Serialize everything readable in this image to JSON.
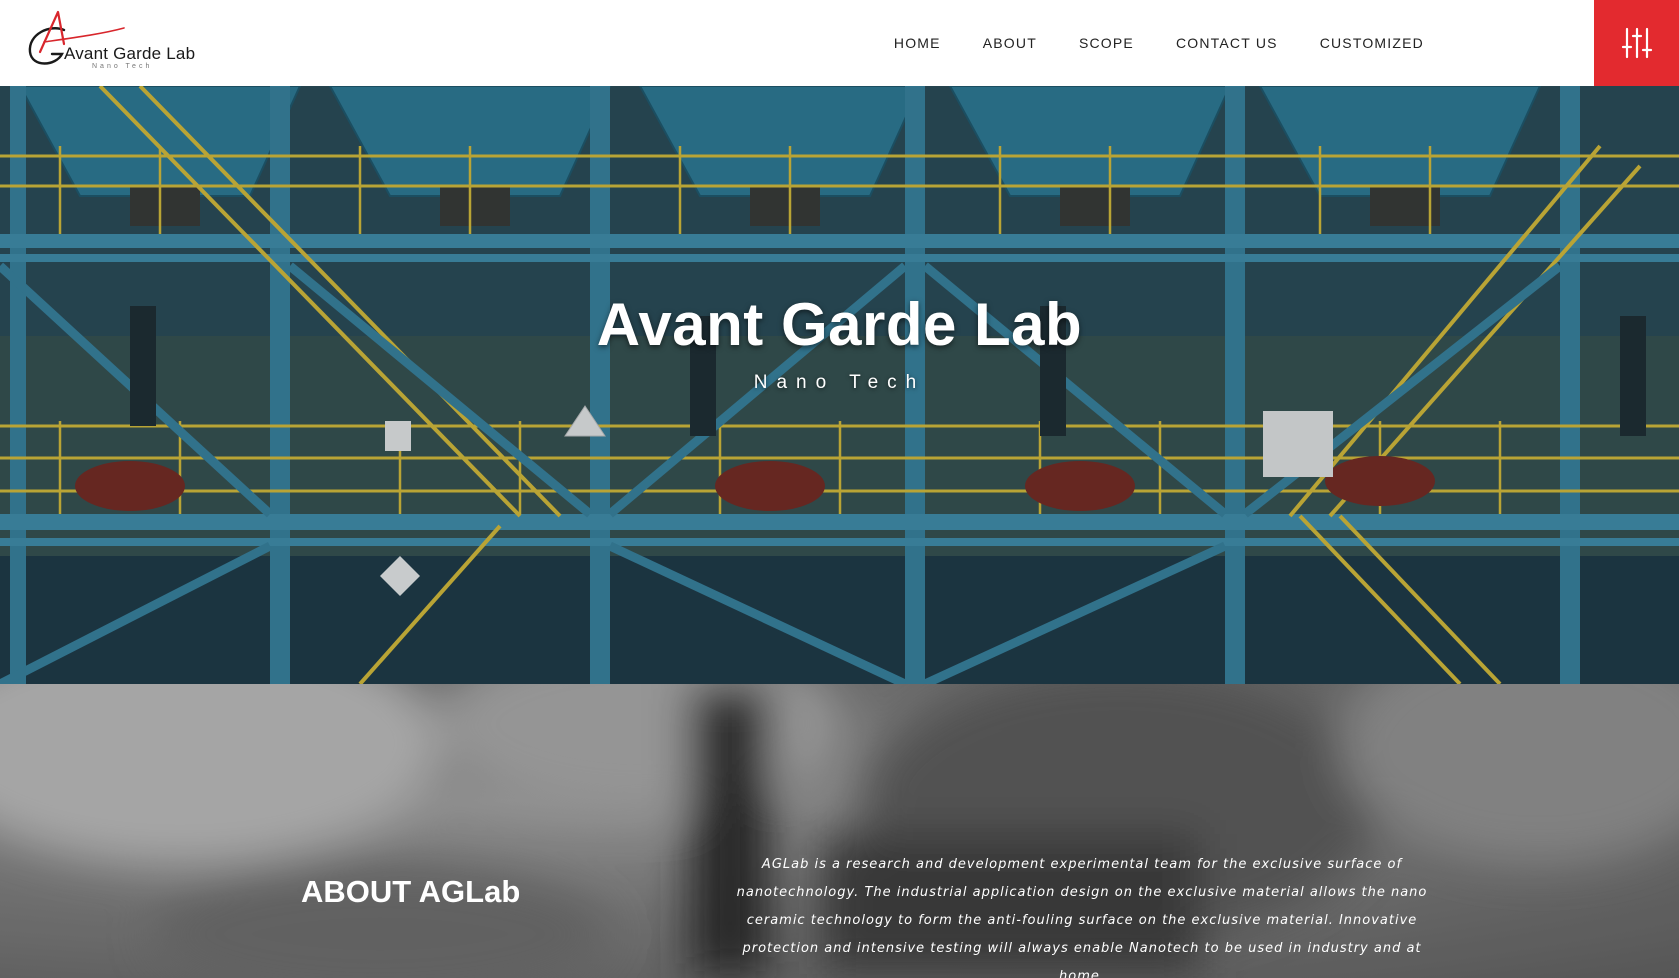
{
  "brand": {
    "name": "Avant Garde Lab",
    "tagline": "Nano Tech"
  },
  "nav": {
    "items": [
      {
        "label": "HOME"
      },
      {
        "label": "ABOUT"
      },
      {
        "label": "SCOPE"
      },
      {
        "label": "CONTACT US"
      },
      {
        "label": "CUSTOMIZED"
      }
    ],
    "menu_icon": "sliders-icon"
  },
  "hero": {
    "title": "Avant Garde Lab",
    "subtitle": "Nano Tech",
    "background": "industrial-plant-photo"
  },
  "about": {
    "title": "ABOUT AGLab",
    "text": "AGLab is a research and development experimental team for the exclusive surface of nanotechnology. The industrial application design on the exclusive material allows the nano ceramic technology to form the anti-fouling surface on the exclusive material. Innovative protection and intensive testing will always enable Nanotech to be used in industry and at home.",
    "background": "blurred-lab-photo"
  },
  "colors": {
    "accent": "#e32a2f",
    "nav_text": "#222222",
    "hero_steel": "#2f6f86",
    "hero_rail": "#e0c23a"
  }
}
